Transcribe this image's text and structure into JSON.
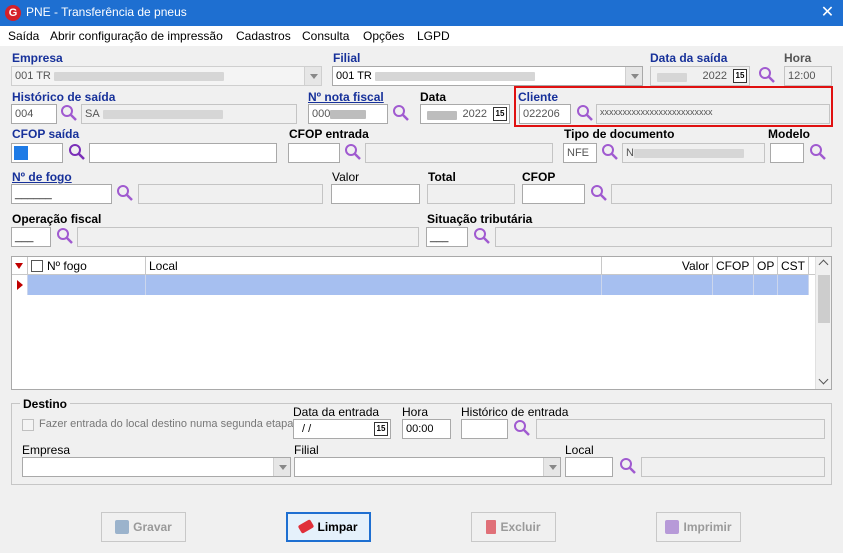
{
  "window": {
    "title": "PNE - Transferência de pneus",
    "logo": "G"
  },
  "menu": [
    "Saída",
    "Abrir configuração de impressão",
    "Cadastros",
    "Consulta",
    "Opções",
    "LGPD"
  ],
  "labels": {
    "empresa": "Empresa",
    "filial": "Filial",
    "data_saida": "Data da saída",
    "hora": "Hora",
    "historico_saida": "Histórico de saída",
    "nota_fiscal": "Nº nota fiscal",
    "data": "Data",
    "cliente": "Cliente",
    "cfop_saida": "CFOP saída",
    "cfop_entrada": "CFOP entrada",
    "tipo_documento": "Tipo de documento",
    "modelo": "Modelo",
    "numero_fogo": "Nº de fogo",
    "valor": "Valor",
    "total": "Total",
    "cfop": "CFOP",
    "operacao_fiscal": "Operação fiscal",
    "situacao_tributaria": "Situação tributária"
  },
  "values": {
    "empresa_prefix": "001 TR",
    "filial_prefix": "001 TR",
    "data_saida_year": "2022",
    "hora": "12:00",
    "historico_code": "004",
    "historico_prefix": "SA",
    "nota_prefix": "000",
    "data_year": "2022",
    "cliente_code": "022206",
    "cliente_name": "xxxxxxxxxxxxxxxxxxxxxxxxx",
    "tipo_documento": "NFE",
    "tipo_doc_prefix": "N",
    "numero_fogo": "______",
    "operacao": "___",
    "situacao": "___"
  },
  "grid": {
    "headers": {
      "nfogo": "Nº fogo",
      "local": "Local",
      "valor": "Valor",
      "cfop": "CFOP",
      "op": "OP",
      "cst": "CST"
    }
  },
  "destino": {
    "title": "Destino",
    "checkbox_label": "Fazer entrada do local destino numa segunda etapa",
    "data_entrada_label": "Data da entrada",
    "data_entrada_value": " /  /",
    "hora_label": "Hora",
    "hora_value": "00:00",
    "historico_label": "Histórico de entrada",
    "empresa_label": "Empresa",
    "filial_label": "Filial",
    "local_label": "Local"
  },
  "buttons": {
    "gravar": "Gravar",
    "limpar": "Limpar",
    "excluir": "Excluir",
    "imprimir": "Imprimir"
  },
  "colors": {
    "titlebar": "#1e6fd1",
    "highlight": "#e01010",
    "label_blue": "#17319a",
    "selected_row": "#a6bff0",
    "search_icon": "#a05ad0"
  }
}
